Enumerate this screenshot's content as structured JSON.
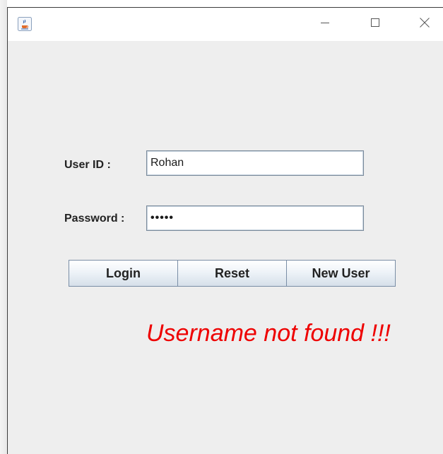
{
  "window": {
    "icon": "java-cup-icon",
    "controls": {
      "minimize": "minimize-icon",
      "maximize": "maximize-icon",
      "close": "close-icon"
    }
  },
  "form": {
    "user_label": "User ID :",
    "user_value": "Rohan",
    "password_label": "Password :",
    "password_value": "•••••"
  },
  "buttons": {
    "login": "Login",
    "reset": "Reset",
    "new_user": "New User"
  },
  "message": {
    "text": "Username not found !!!",
    "color": "#ee0000"
  },
  "colors": {
    "background": "#eeeeee",
    "titlebar": "#ffffff"
  }
}
